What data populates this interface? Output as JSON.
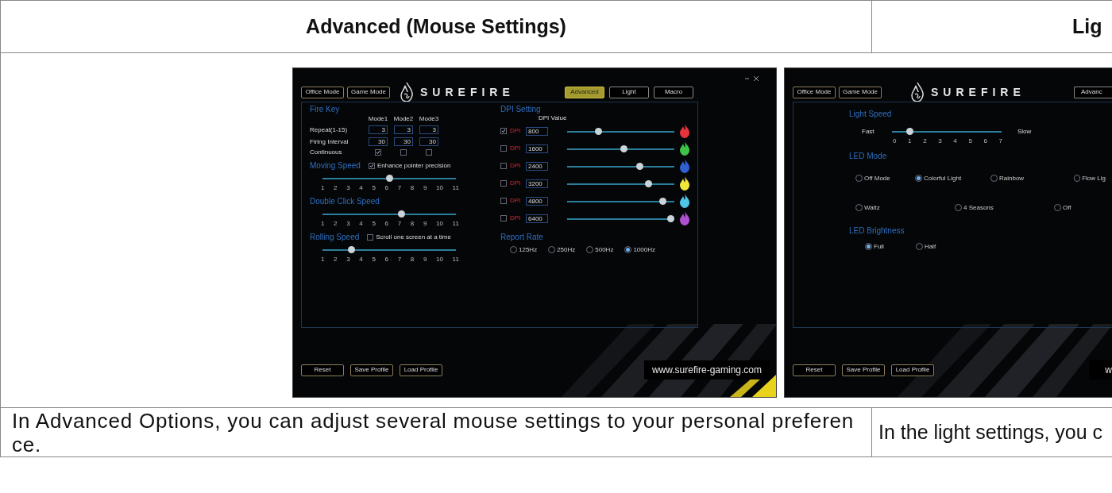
{
  "table": {
    "headers": [
      "Advanced (Mouse Settings)",
      "Lig"
    ],
    "captions": [
      "In Advanced Options, you can adjust several mouse settings to your personal preference.",
      "In the light settings, you c"
    ]
  },
  "advanced_screenshot": {
    "mode_buttons": [
      "Office Mode",
      "Game Mode"
    ],
    "logo": "SUREFIRE",
    "tabs": [
      {
        "label": "Advanced",
        "selected": true
      },
      {
        "label": "Light",
        "selected": false
      },
      {
        "label": "Macro",
        "selected": false
      }
    ],
    "fire_key": {
      "title": "Fire Key",
      "columns": [
        "Mode1",
        "Mode2",
        "Mode3"
      ],
      "rows": [
        {
          "kind": "numbers",
          "label": "Repeat(1-15)",
          "values": [
            "3",
            "3",
            "3"
          ]
        },
        {
          "kind": "numbers",
          "label": "Firing Interval",
          "values": [
            "30",
            "30",
            "30"
          ]
        },
        {
          "kind": "checks",
          "label": "Continuous",
          "checks": [
            true,
            false,
            false
          ]
        }
      ]
    },
    "speeds": [
      {
        "title": "Moving Speed",
        "option": {
          "label": "Enhance pointer precision",
          "checked": true
        },
        "level": 0.5,
        "ticks": [
          "1",
          "2",
          "3",
          "4",
          "5",
          "6",
          "7",
          "8",
          "9",
          "10",
          "11"
        ]
      },
      {
        "title": "Double Click Speed",
        "level": 0.6,
        "ticks": [
          "1",
          "2",
          "3",
          "4",
          "5",
          "6",
          "7",
          "8",
          "9",
          "10",
          "11"
        ]
      },
      {
        "title": "Rolling Speed",
        "option": {
          "label": "Scroll one screen at a time",
          "checked": false
        },
        "level": 0.2,
        "ticks": [
          "1",
          "2",
          "3",
          "4",
          "5",
          "6",
          "7",
          "8",
          "9",
          "10",
          "11"
        ]
      }
    ],
    "dpi": {
      "title": "DPI Setting",
      "value_header": "DPI Value",
      "rows": [
        {
          "checked": true,
          "label": "DPI",
          "value": "800",
          "level": 0.28,
          "color": "#e8323a"
        },
        {
          "checked": false,
          "label": "DPI",
          "value": "1600",
          "level": 0.53,
          "color": "#3fc24a"
        },
        {
          "checked": false,
          "label": "DPI",
          "value": "2400",
          "level": 0.69,
          "color": "#2f5fd0"
        },
        {
          "checked": false,
          "label": "DPI",
          "value": "3200",
          "level": 0.78,
          "color": "#f2e63a"
        },
        {
          "checked": false,
          "label": "DPI",
          "value": "4800",
          "level": 0.92,
          "color": "#4fc6e8"
        },
        {
          "checked": false,
          "label": "DPI",
          "value": "6400",
          "level": 1,
          "color": "#b050d0"
        }
      ]
    },
    "report_rate": {
      "title": "Report Rate",
      "options": [
        {
          "label": "125Hz",
          "selected": false
        },
        {
          "label": "250Hz",
          "selected": false
        },
        {
          "label": "500Hz",
          "selected": false
        },
        {
          "label": "1000Hz",
          "selected": true
        }
      ]
    },
    "footer_buttons": [
      "Reset",
      "Save Profile",
      "Load Profile"
    ],
    "url": "www.surefire-gaming.com"
  },
  "light_screenshot": {
    "mode_buttons": [
      "Office Mode",
      "Game Mode"
    ],
    "logo": "SUREFIRE",
    "tabs": [
      {
        "label": "Advanc",
        "selected": false
      }
    ],
    "light_speed": {
      "title": "Light Speed",
      "start": "Fast",
      "end": "Slow",
      "level": 0.14,
      "ticks": [
        "0",
        "1",
        "2",
        "3",
        "4",
        "5",
        "6",
        "7"
      ]
    },
    "led_mode": {
      "title": "LED Mode",
      "rows": [
        [
          {
            "label": "Off Mode",
            "selected": false
          },
          {
            "label": "Colorful Light",
            "selected": true
          },
          {
            "label": "Rainbow",
            "selected": false
          },
          {
            "label": "Flow Lig",
            "selected": false
          }
        ],
        [
          {
            "label": "Waltz",
            "selected": false
          },
          {
            "label": "4 Seasons",
            "selected": false
          },
          {
            "label": "Off",
            "selected": false
          }
        ]
      ]
    },
    "led_brightness": {
      "title": "LED Brightness",
      "options": [
        {
          "label": "Full",
          "selected": true
        },
        {
          "label": "Half",
          "selected": false
        }
      ]
    },
    "footer_buttons": [
      "Reset",
      "Save Profile",
      "Load Profile"
    ],
    "url": "w"
  }
}
